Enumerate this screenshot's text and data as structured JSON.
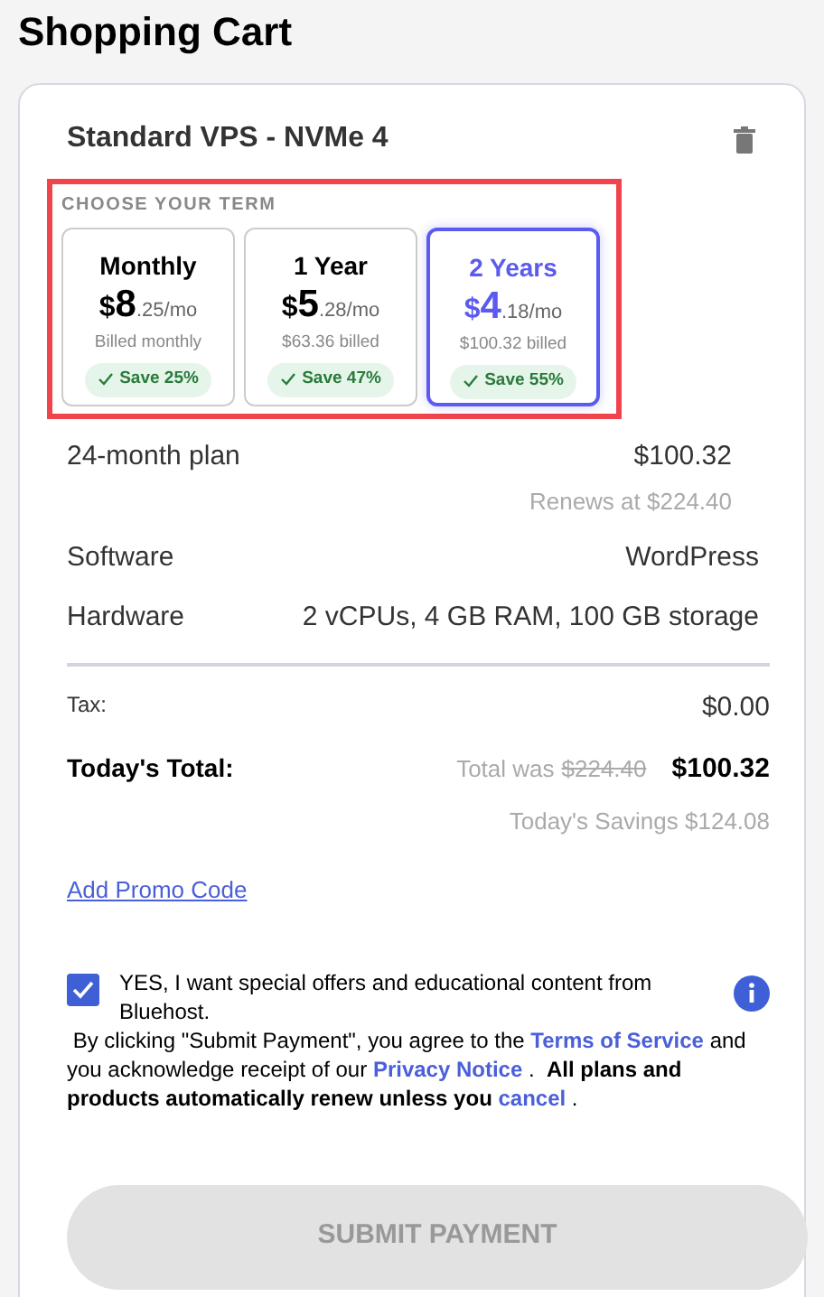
{
  "title": "Shopping Cart",
  "product": {
    "name": "Standard VPS - NVMe 4",
    "term_heading": "CHOOSE YOUR TERM",
    "terms": [
      {
        "label": "Monthly",
        "currency": "$",
        "whole": "8",
        "cents": ".25/mo",
        "billed": "Billed monthly",
        "save": "Save 25%",
        "selected": false
      },
      {
        "label": "1 Year",
        "currency": "$",
        "whole": "5",
        "cents": ".28/mo",
        "billed": "$63.36 billed",
        "save": "Save 47%",
        "selected": false
      },
      {
        "label": "2 Years",
        "currency": "$",
        "whole": "4",
        "cents": ".18/mo",
        "billed": "$100.32 billed",
        "save": "Save 55%",
        "selected": true
      }
    ]
  },
  "plan": {
    "label": "24-month plan",
    "price": "$100.32",
    "renews": "Renews at $224.40"
  },
  "specs": [
    {
      "label": "Software",
      "value": "WordPress"
    },
    {
      "label": "Hardware",
      "value": "2 vCPUs, 4 GB RAM, 100 GB storage"
    }
  ],
  "tax": {
    "label": "Tax:",
    "value": "$0.00"
  },
  "total": {
    "label": "Today's Total:",
    "was_label": "Total was",
    "was_value": "$224.40",
    "value": "$100.32",
    "savings": "Today's Savings $124.08"
  },
  "promo_link": "Add Promo Code",
  "consent": {
    "text": "YES, I want special offers and educational content from Bluehost.",
    "checked": true
  },
  "legal": [
    {
      "kind": "text",
      "text": " By clicking \"Submit Payment\", you agree to the "
    },
    {
      "kind": "link",
      "text": "Terms of Service"
    },
    {
      "kind": "text",
      "text": " and you acknowledge receipt of our "
    },
    {
      "kind": "link",
      "text": "Privacy Notice"
    },
    {
      "kind": "text",
      "text": " .  "
    },
    {
      "kind": "bold",
      "text": "All plans and products automatically renew unless you "
    },
    {
      "kind": "link",
      "text": "cancel"
    },
    {
      "kind": "text",
      "text": " ."
    }
  ],
  "submit": {
    "label": "SUBMIT PAYMENT",
    "disabled": true
  }
}
